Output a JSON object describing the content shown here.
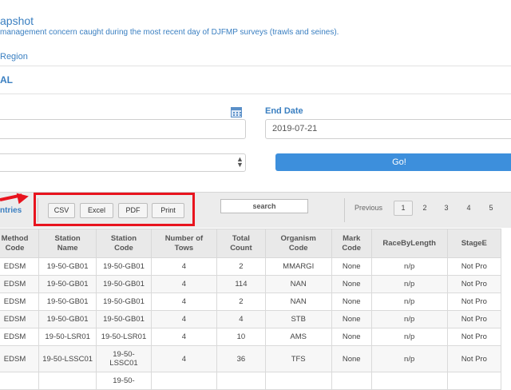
{
  "header": {
    "title": "apshot",
    "subtitle": "management concern caught during the most recent day of DJFMP surveys (trawls and seines).",
    "region_link": "Region",
    "section": "AL"
  },
  "form": {
    "end_date_label": "End Date",
    "end_date_value": "2019-07-21",
    "go_label": "Go!"
  },
  "toolbar": {
    "entries_label": "ntries",
    "buttons": [
      "CSV",
      "Excel",
      "PDF",
      "Print"
    ],
    "search_label": "search",
    "previous_label": "Previous",
    "pages": [
      "1",
      "2",
      "3",
      "4",
      "5"
    ],
    "active_page": "1"
  },
  "table": {
    "columns": [
      [
        "Method",
        "Code"
      ],
      [
        "Station",
        "Name"
      ],
      [
        "Station",
        "Code"
      ],
      [
        "Number of",
        "Tows"
      ],
      [
        "Total",
        "Count"
      ],
      [
        "Organism",
        "Code"
      ],
      [
        "Mark",
        "Code"
      ],
      [
        "RaceByLength",
        ""
      ],
      [
        "StageE",
        ""
      ]
    ],
    "rows": [
      [
        "EDSM",
        "19-50-GB01",
        "19-50-GB01",
        "4",
        "2",
        "MMARGI",
        "None",
        "n/p",
        "Not Pro"
      ],
      [
        "EDSM",
        "19-50-GB01",
        "19-50-GB01",
        "4",
        "114",
        "NAN",
        "None",
        "n/p",
        "Not Pro"
      ],
      [
        "EDSM",
        "19-50-GB01",
        "19-50-GB01",
        "4",
        "2",
        "NAN",
        "None",
        "n/p",
        "Not Pro"
      ],
      [
        "EDSM",
        "19-50-GB01",
        "19-50-GB01",
        "4",
        "4",
        "STB",
        "None",
        "n/p",
        "Not Pro"
      ],
      [
        "EDSM",
        "19-50-LSR01",
        "19-50-LSR01",
        "4",
        "10",
        "AMS",
        "None",
        "n/p",
        "Not Pro"
      ],
      [
        "EDSM",
        "19-50-LSSC01",
        "19-50-\nLSSC01",
        "4",
        "36",
        "TFS",
        "None",
        "n/p",
        "Not Pro"
      ],
      [
        "",
        "",
        "19-50-",
        "",
        "",
        "",
        "",
        "",
        ""
      ]
    ]
  }
}
